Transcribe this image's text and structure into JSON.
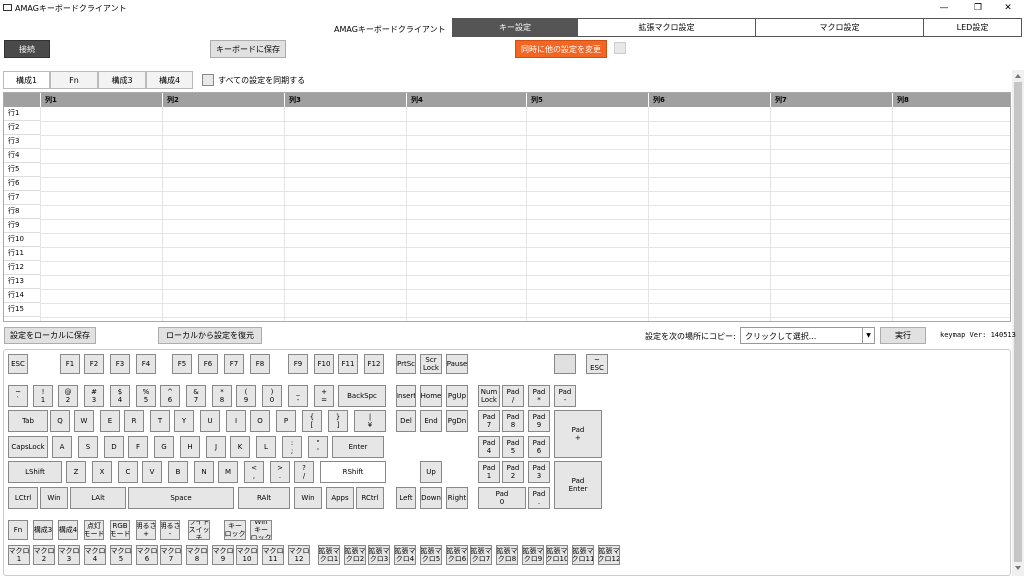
{
  "window": {
    "title": "AMAGキーボードクライアント",
    "controls": [
      "—",
      "❐",
      "✕"
    ]
  },
  "tabs": {
    "app_label": "AMAGキーボードクライアント",
    "items": [
      "キー設定",
      "拡張マクロ設定",
      "マクロ設定",
      "LED設定"
    ]
  },
  "toolbar": {
    "connect": "接続",
    "save_to_keyboard": "キーボードに保存",
    "change_other": "同時に他の設定を変更"
  },
  "config_tabs": [
    "構成1",
    "Fn",
    "構成3",
    "構成4"
  ],
  "sync_all_label": "すべての設定を同期する",
  "grid": {
    "columns": [
      "列1",
      "列2",
      "列3",
      "列4",
      "列5",
      "列6",
      "列7",
      "列8"
    ],
    "rows": [
      "行1",
      "行2",
      "行3",
      "行4",
      "行5",
      "行6",
      "行7",
      "行8",
      "行9",
      "行10",
      "行11",
      "行12",
      "行13",
      "行14",
      "行15"
    ]
  },
  "bottom_bar": {
    "save_local": "設定をローカルに保存",
    "restore_local": "ローカルから設定を復元",
    "copy_label": "設定を次の場所にコピー:",
    "copy_placeholder": "クリックして選択...",
    "execute": "実行",
    "version": "keymap Ver: 140513"
  },
  "keys": {
    "r0": [
      "ESC",
      "F1",
      "F2",
      "F3",
      "F4",
      "F5",
      "F6",
      "F7",
      "F8",
      "F9",
      "F10",
      "F11",
      "F12",
      "PrtSc",
      "Scr\nLock",
      "Pause",
      "",
      "~\nESC"
    ],
    "r1": [
      "~\n`",
      "!\n1",
      "@\n2",
      "#\n3",
      "$\n4",
      "%\n5",
      "^\n6",
      "&\n7",
      "*\n8",
      "(\n9",
      ")\n0",
      "_\n-",
      "+\n=",
      "BackSpc",
      "Insert",
      "Home",
      "PgUp",
      "Num\nLock",
      "Pad\n/",
      "Pad\n*",
      "Pad\n-"
    ],
    "r2": [
      "Tab",
      "Q",
      "W",
      "E",
      "R",
      "T",
      "Y",
      "U",
      "I",
      "O",
      "P",
      "{\n[",
      "}\n]",
      "|\n¥",
      "Del",
      "End",
      "PgDn",
      "Pad\n7",
      "Pad\n8",
      "Pad\n9",
      "Pad\n+"
    ],
    "r3": [
      "CapsLock",
      "A",
      "S",
      "D",
      "F",
      "G",
      "H",
      "J",
      "K",
      "L",
      ":\n;",
      "\"\n'",
      "Enter",
      "Pad\n4",
      "Pad\n5",
      "Pad\n6"
    ],
    "r4": [
      "LShift",
      "Z",
      "X",
      "C",
      "V",
      "B",
      "N",
      "M",
      "<\n,",
      ">\n.",
      "?\n/",
      "RShift",
      "Up",
      "Pad\n1",
      "Pad\n2",
      "Pad\n3",
      "Pad\nEnter"
    ],
    "r5": [
      "LCtrl",
      "Win",
      "LAlt",
      "Space",
      "RAlt",
      "Win",
      "Apps",
      "RCtrl",
      "Left",
      "Down",
      "Right",
      "Pad\n0",
      "Pad\n."
    ],
    "r6": [
      "Fn",
      "構成3",
      "構成4",
      "点灯\nモード",
      "RGB\nモード",
      "明るさ\n+",
      "明るさ\n-",
      "ライト\nスイッ\nチ",
      "キー\nロック",
      "Win\nキー\nロック"
    ],
    "r7": [
      "マクロ\n1",
      "マクロ\n2",
      "マクロ\n3",
      "マクロ\n4",
      "マクロ\n5",
      "マクロ\n6",
      "マクロ\n7",
      "マクロ\n8",
      "マクロ\n9",
      "マクロ\n10",
      "マクロ\n11",
      "マクロ\n12",
      "拡張マ\nクロ1",
      "拡張マ\nクロ2",
      "拡張マ\nクロ3",
      "拡張マ\nクロ4",
      "拡張マ\nクロ5",
      "拡張マ\nクロ6",
      "拡張マ\nクロ7",
      "拡張マ\nクロ8",
      "拡張マ\nクロ9",
      "拡張マ\nクロ10",
      "拡張マ\nクロ11",
      "拡張マ\nクロ12"
    ]
  },
  "colors": {
    "accent": "#f26522",
    "tab_active": "#555555",
    "header_bg": "#a0a0a0"
  }
}
